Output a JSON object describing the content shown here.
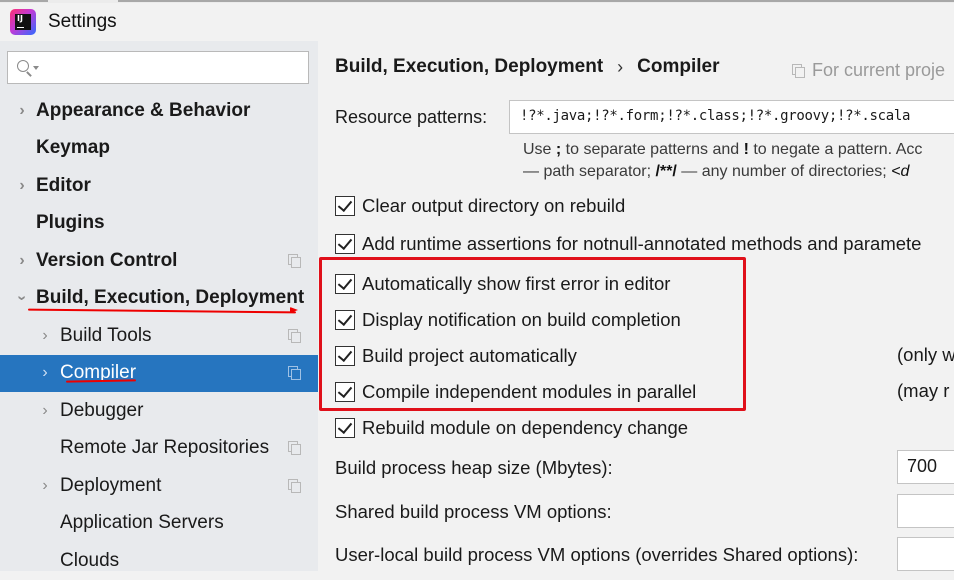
{
  "window": {
    "title": "Settings",
    "app_icon": "intellij-idea-icon"
  },
  "sidebar": {
    "search": {
      "value": "",
      "placeholder": "",
      "icon": "search-icon"
    },
    "items": [
      {
        "label": "Appearance & Behavior",
        "level": 0,
        "bold": true,
        "expandable": true,
        "expanded": false,
        "project_icon": false
      },
      {
        "label": "Keymap",
        "level": 0,
        "bold": true,
        "expandable": false,
        "project_icon": false
      },
      {
        "label": "Editor",
        "level": 0,
        "bold": true,
        "expandable": true,
        "expanded": false,
        "project_icon": false
      },
      {
        "label": "Plugins",
        "level": 0,
        "bold": true,
        "expandable": false,
        "project_icon": false
      },
      {
        "label": "Version Control",
        "level": 0,
        "bold": true,
        "expandable": true,
        "expanded": false,
        "project_icon": true
      },
      {
        "label": "Build, Execution, Deployment",
        "level": 0,
        "bold": true,
        "expandable": true,
        "expanded": true,
        "project_icon": false
      },
      {
        "label": "Build Tools",
        "level": 1,
        "bold": false,
        "expandable": true,
        "expanded": false,
        "project_icon": true
      },
      {
        "label": "Compiler",
        "level": 1,
        "bold": false,
        "expandable": true,
        "expanded": false,
        "project_icon": true,
        "selected": true
      },
      {
        "label": "Debugger",
        "level": 1,
        "bold": false,
        "expandable": true,
        "expanded": false,
        "project_icon": false
      },
      {
        "label": "Remote Jar Repositories",
        "level": 1,
        "bold": false,
        "expandable": false,
        "project_icon": true
      },
      {
        "label": "Deployment",
        "level": 1,
        "bold": false,
        "expandable": true,
        "expanded": false,
        "project_icon": true
      },
      {
        "label": "Application Servers",
        "level": 1,
        "bold": false,
        "expandable": false,
        "project_icon": false
      },
      {
        "label": "Clouds",
        "level": 1,
        "bold": false,
        "expandable": false,
        "project_icon": false
      }
    ]
  },
  "main": {
    "breadcrumb": {
      "parent": "Build, Execution, Deployment",
      "separator": "›",
      "current": "Compiler"
    },
    "scope_note": "For current proje",
    "resource_patterns": {
      "label": "Resource patterns:",
      "value": "!?*.java;!?*.form;!?*.class;!?*.groovy;!?*.scala"
    },
    "hint": {
      "line1": {
        "a": "Use ",
        "b1": ";",
        "c": " to separate patterns and ",
        "b2": "!",
        "d": " to negate a pattern. Acc"
      },
      "line2": {
        "a": "— path separator; ",
        "b1": "/**/",
        "c": " — any number of directories; ",
        "i": "<d"
      }
    },
    "checkboxes": [
      {
        "label": "Clear output directory on rebuild",
        "checked": true
      },
      {
        "label": "Add runtime assertions for notnull-annotated methods and paramete",
        "checked": true
      },
      {
        "label": "Automatically show first error in editor",
        "checked": true,
        "highlighted": true
      },
      {
        "label": "Display notification on build completion",
        "checked": true,
        "highlighted": true
      },
      {
        "label": "Build project automatically",
        "checked": true,
        "highlighted": true,
        "note": "(only w"
      },
      {
        "label": "Compile independent modules in parallel",
        "checked": true,
        "highlighted": true,
        "note": "(may r"
      },
      {
        "label": "Rebuild module on dependency change",
        "checked": true
      }
    ],
    "fields": [
      {
        "label": "Build process heap size (Mbytes):",
        "value": "700"
      },
      {
        "label": "Shared build process VM options:",
        "value": ""
      },
      {
        "label": "User-local build process VM options (overrides Shared options):",
        "value": ""
      }
    ]
  },
  "annotations": {
    "color": "#e0101a",
    "highlight_box_label": "highlighted-checkbox-group"
  }
}
